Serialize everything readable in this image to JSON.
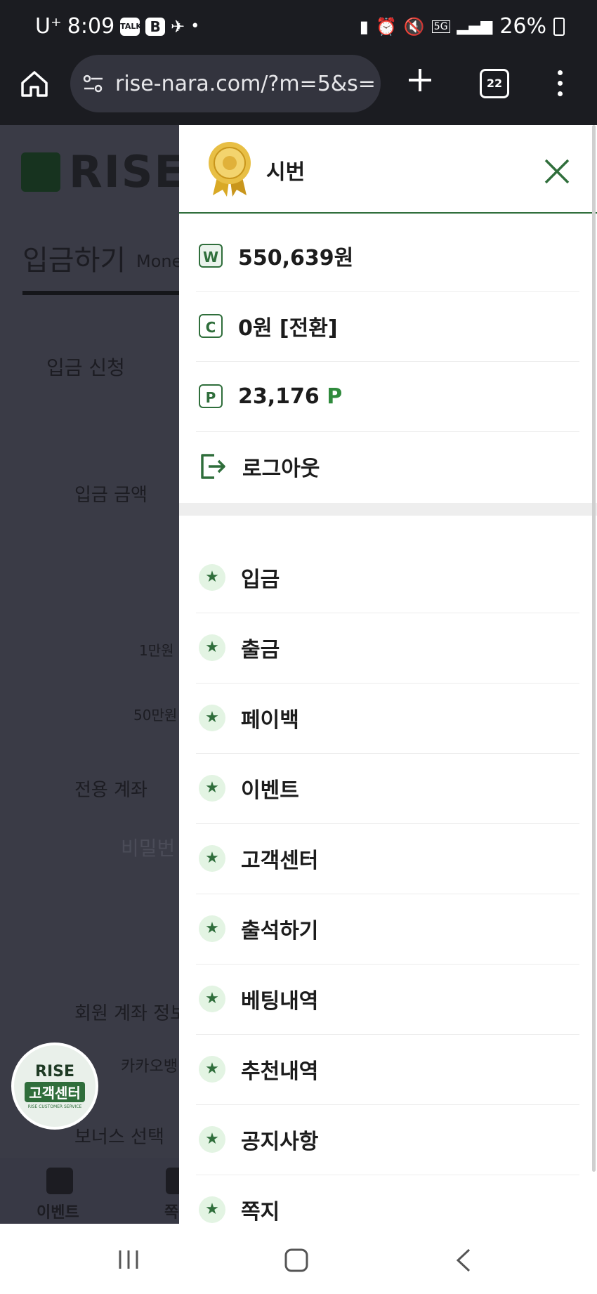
{
  "status_bar": {
    "carrier": "U⁺",
    "time": "8:09",
    "talk_icon_text": "TALK",
    "b_icon_text": "B",
    "dot": "•",
    "network": "5G",
    "battery": "26%"
  },
  "browser": {
    "url": "rise-nara.com/?m=5&s=",
    "tab_count": "22"
  },
  "background_page": {
    "logo_text": "RISE",
    "title": "입금하기",
    "subtitle": "Mone",
    "section": "입금 신청",
    "amount_label": "입금 금액",
    "btn_10k": "1만원",
    "btn_500k": "50만원",
    "account_label": "전용 계좌",
    "password_placeholder": "비밀번",
    "member_account_label": "회원 계좌 정보",
    "bank": "카카오뱅",
    "bonus_label": "보너스 선택",
    "nav_event": "이벤트",
    "nav_second": "쪽"
  },
  "floating_button": {
    "top": "RISE",
    "main": "고객센터",
    "mini": "RISE CUSTOMER SERVICE"
  },
  "drawer": {
    "username": "시번",
    "balances": [
      {
        "icon": "W",
        "value": "550,639원"
      },
      {
        "icon": "C",
        "value": "0원 [전환]"
      },
      {
        "icon": "P",
        "value": "23,176",
        "suffix": "P"
      }
    ],
    "logout": "로그아웃",
    "menu": [
      "입금",
      "출금",
      "페이백",
      "이벤트",
      "고객센터",
      "출석하기",
      "베팅내역",
      "추천내역",
      "공지사항",
      "쪽지"
    ]
  },
  "colors": {
    "accent": "#2f6e3b",
    "star_bg": "#e3f4e3"
  }
}
